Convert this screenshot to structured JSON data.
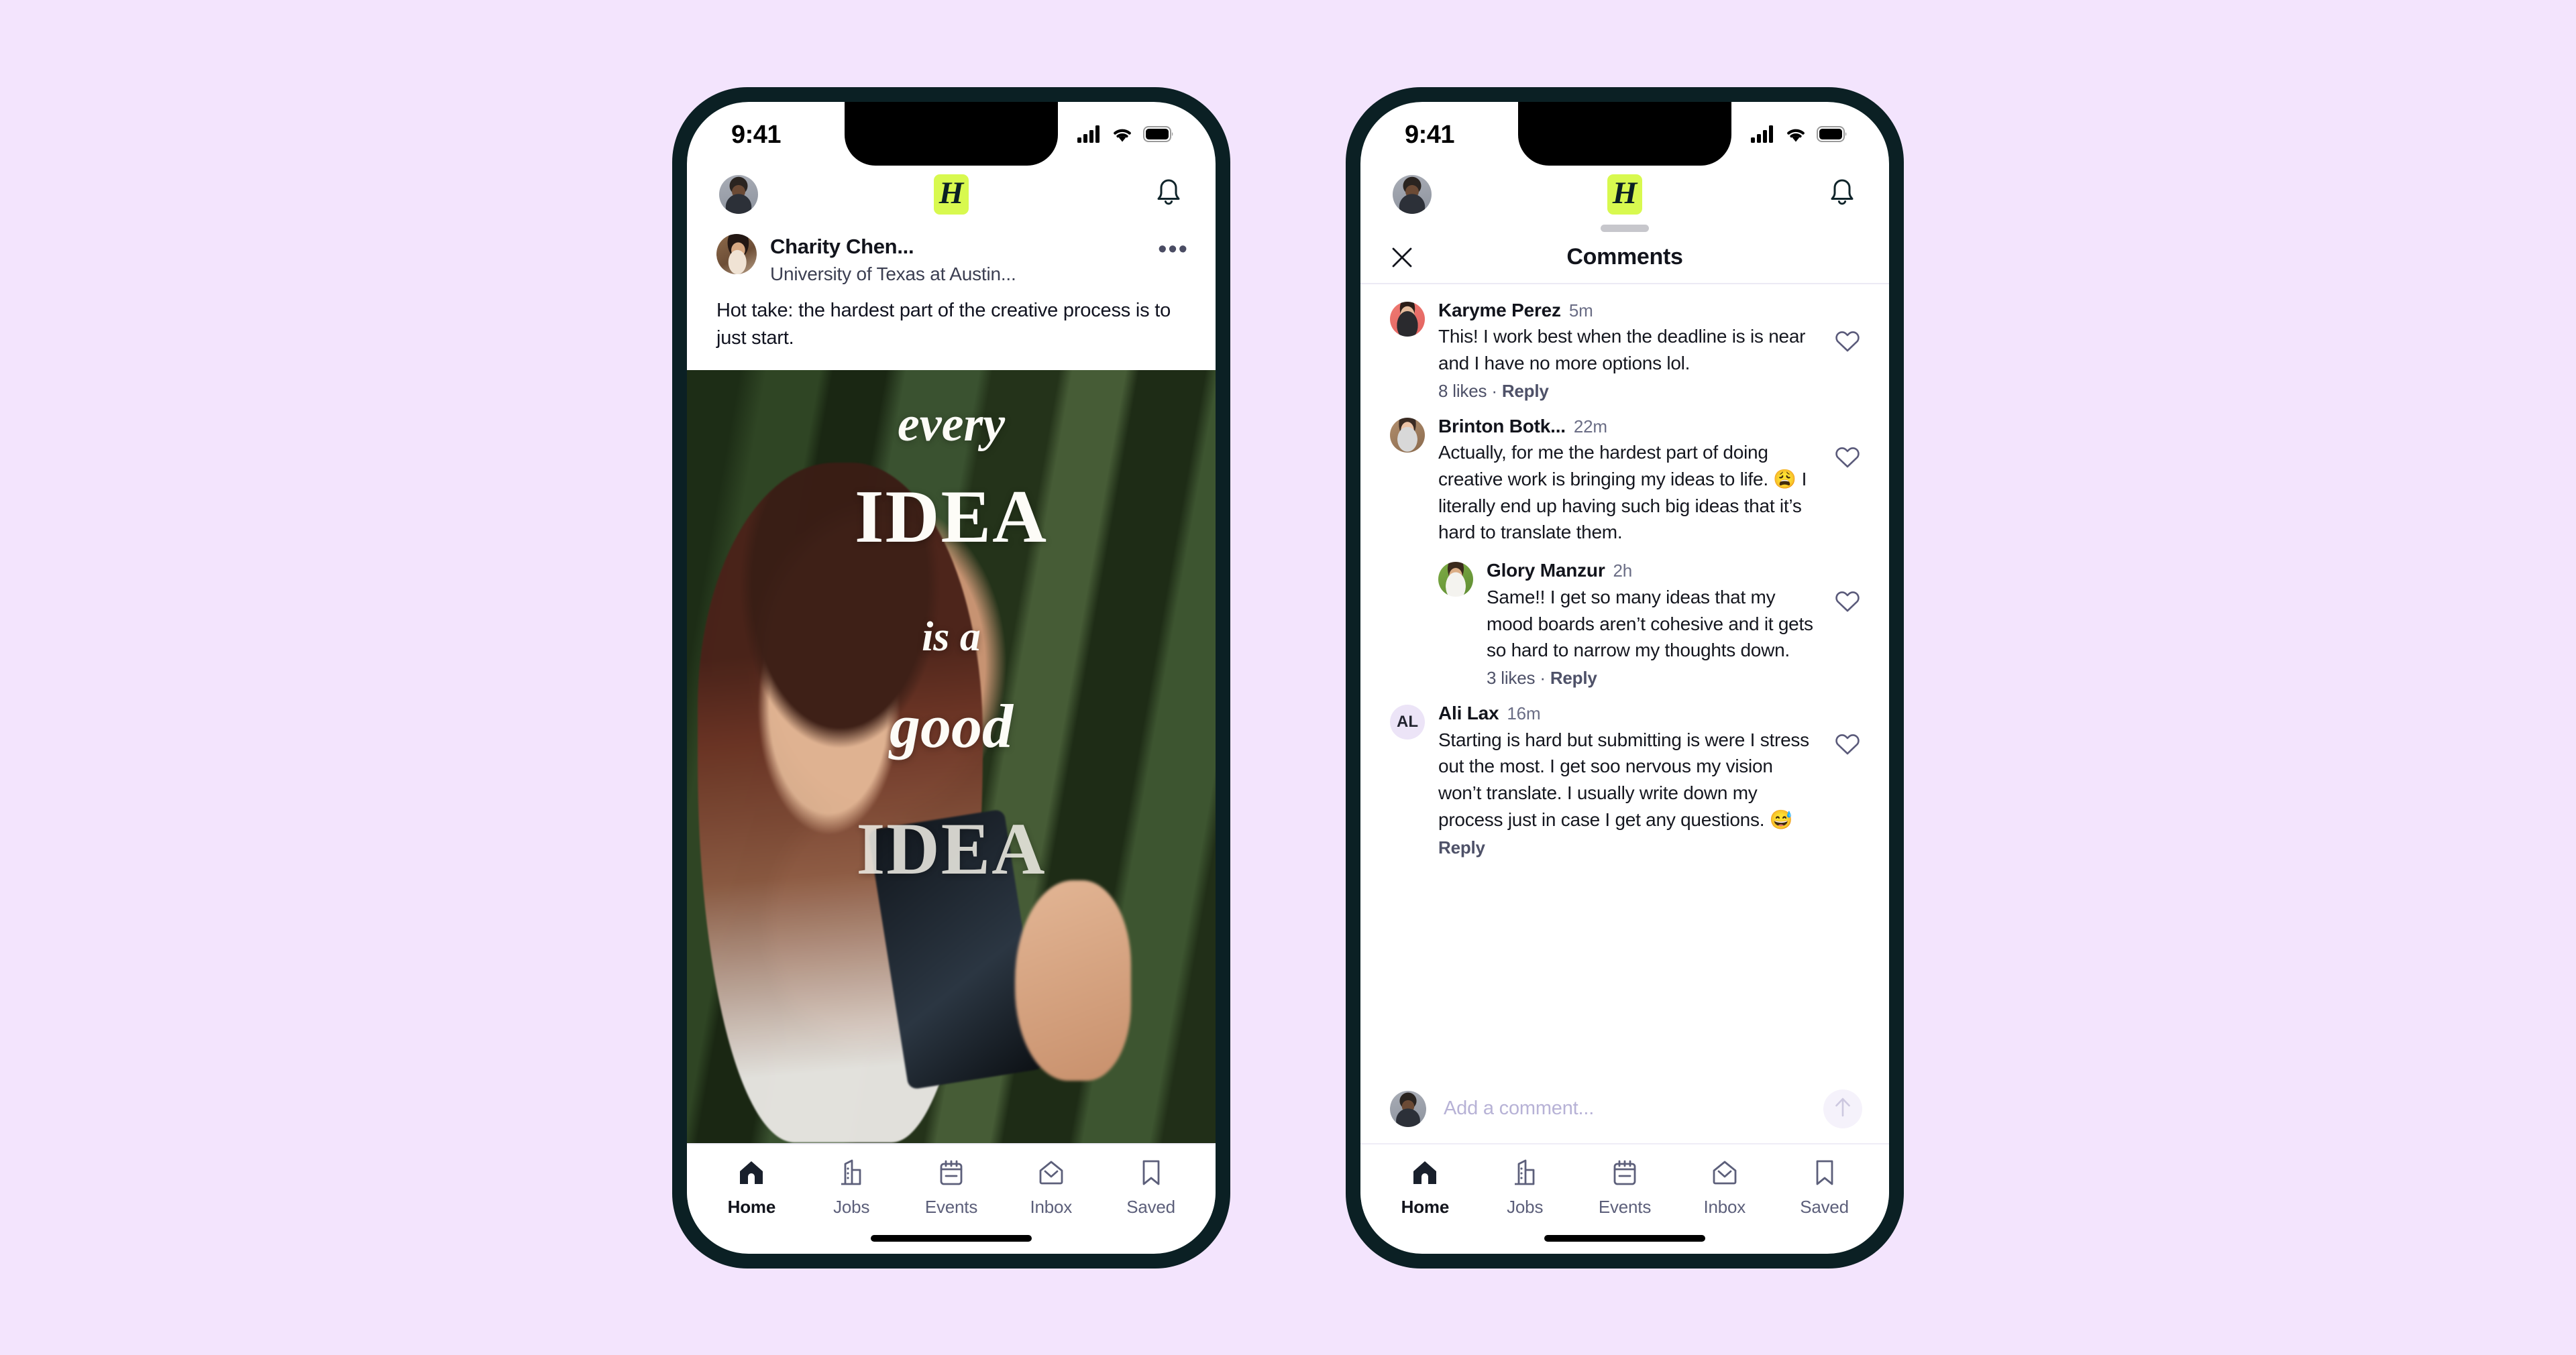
{
  "background_color": "#f3e4fd",
  "frame_color": "#0b2024",
  "brand": {
    "logo_letter": "H",
    "logo_bg": "#d8f94f",
    "logo_fg": "#0b2024"
  },
  "status_bar": {
    "time": "9:41",
    "icons": [
      "cellular-signal-icon",
      "wifi-icon",
      "battery-icon"
    ]
  },
  "left_phone": {
    "header": {
      "avatar": "user-avatar",
      "logo": "H",
      "notification_icon": "bell-icon"
    },
    "post": {
      "author_name": "Charity Chen...",
      "author_subtitle": "University of Texas at Austin...",
      "more_label": "•••",
      "body": "Hot take: the hardest part of the creative process is to just start.",
      "media_overlay_lines": [
        "every",
        "IDEA",
        "is a",
        "good",
        "IDEA"
      ]
    }
  },
  "right_phone": {
    "header": {
      "avatar": "user-avatar",
      "logo": "H",
      "notification_icon": "bell-icon"
    },
    "sheet": {
      "title": "Comments",
      "close_label": "Close"
    },
    "comments": [
      {
        "name": "Karyme Perez",
        "time": "5m",
        "text": "This! I work best when the deadline is is near and I have no more options lol.",
        "likes": "8 likes",
        "separator": "·",
        "reply": "Reply",
        "avatar_kind": "photo",
        "avatar_class": "av-karyme",
        "is_reply": false
      },
      {
        "name": "Brinton Botk...",
        "time": "22m",
        "text": "Actually, for me the hardest part of doing creative work is bringing my ideas to life. 😩 I literally end up having such big ideas that it’s hard to translate them.",
        "likes": "",
        "separator": "",
        "reply": "",
        "avatar_kind": "photo",
        "avatar_class": "av-brinton",
        "is_reply": false
      },
      {
        "name": "Glory Manzur",
        "time": "2h",
        "text": "Same!! I get so many ideas that my mood boards aren’t cohesive and it gets so hard to narrow my thoughts down.",
        "likes": "3 likes",
        "separator": "·",
        "reply": "Reply",
        "avatar_kind": "photo",
        "avatar_class": "av-glory",
        "is_reply": true
      },
      {
        "name": "Ali Lax",
        "time": "16m",
        "text": "Starting is hard but submitting is were I stress out the most. I get soo nervous my vision won’t translate. I usually write down my process just in case I get any questions. 😅",
        "likes": "",
        "separator": "",
        "reply": "Reply",
        "avatar_kind": "initials",
        "avatar_initials": "AL",
        "is_reply": false
      }
    ],
    "composer": {
      "placeholder": "Add a comment...",
      "value": "",
      "send_icon": "arrow-up-icon"
    }
  },
  "tabbar": {
    "items": [
      {
        "label": "Home",
        "icon": "home-icon",
        "active": true
      },
      {
        "label": "Jobs",
        "icon": "building-icon",
        "active": false
      },
      {
        "label": "Events",
        "icon": "calendar-icon",
        "active": false
      },
      {
        "label": "Inbox",
        "icon": "envelope-icon",
        "active": false
      },
      {
        "label": "Saved",
        "icon": "bookmark-icon",
        "active": false
      }
    ]
  }
}
